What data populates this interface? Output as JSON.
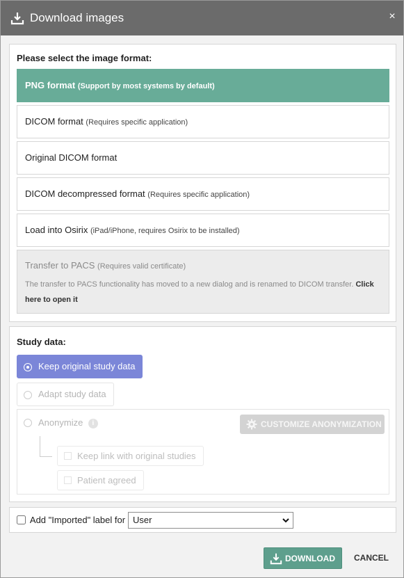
{
  "dialog": {
    "title": "Download images",
    "close_glyph": "×",
    "title_icon": "download-icon"
  },
  "format_section": {
    "heading": "Please select the image format:",
    "options": [
      {
        "label": "PNG format",
        "hint": "(Support by most systems by default)",
        "selected": true
      },
      {
        "label": "DICOM format",
        "hint": "(Requires specific application)"
      },
      {
        "label": "Original DICOM format",
        "hint": ""
      },
      {
        "label": "DICOM decompressed format",
        "hint": "(Requires specific application)"
      },
      {
        "label": "Load into Osirix",
        "hint": "(iPad/iPhone, requires Osirix to be installed)"
      }
    ],
    "pacs": {
      "label": "Transfer to PACS",
      "hint": "(Requires valid certificate)",
      "note": "The transfer to PACS functionality has moved to a new dialog and is renamed to DICOM transfer.",
      "link": "Click here to open it"
    }
  },
  "study_section": {
    "heading": "Study data:",
    "keep_label": "Keep original study data",
    "adapt_label": "Adapt study data",
    "anonymize_label": "Anonymize",
    "info_glyph": "i",
    "customize_label": "CUSTOMIZE ANONYMIZATION",
    "keep_link_label": "Keep link with original studies",
    "patient_agreed_label": "Patient agreed"
  },
  "label_section": {
    "checkbox_label": "Add \"Imported\" label for",
    "selected_value": "User"
  },
  "footer": {
    "download_label": "DOWNLOAD",
    "cancel_label": "CANCEL"
  },
  "colors": {
    "titlebar": "#6b6b6b",
    "selected_format": "#68ac98",
    "selected_radio": "#7b86d8",
    "download_button": "#5e9f8d"
  }
}
